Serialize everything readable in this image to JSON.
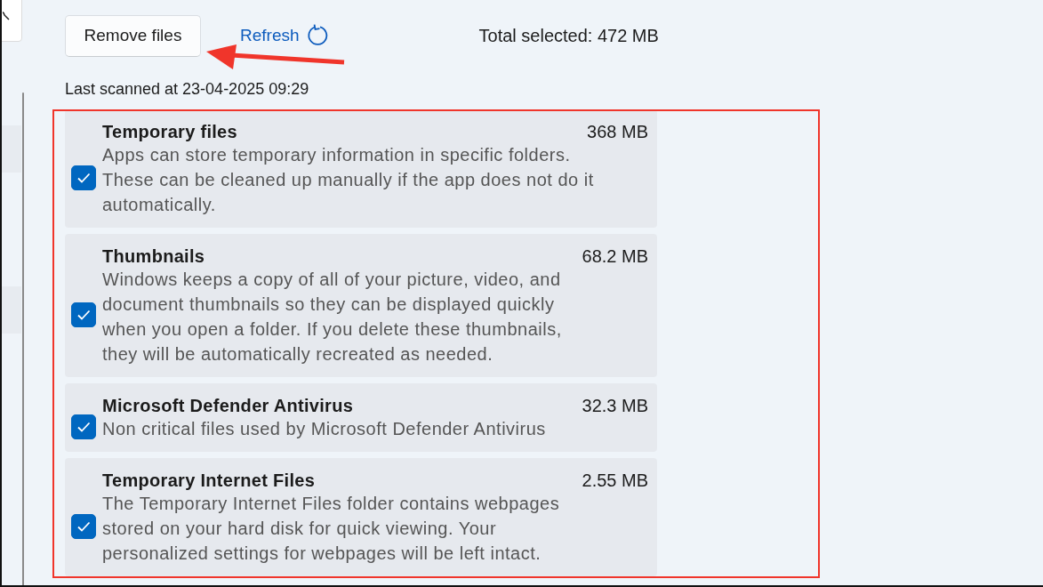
{
  "toolbar": {
    "remove_button": "Remove files",
    "refresh_link": "Refresh",
    "total_selected": "Total selected: 472 MB"
  },
  "last_scanned": "Last scanned at 23-04-2025 09:29",
  "items": [
    {
      "title": "Temporary files",
      "size": "368 MB",
      "description": "Apps can store temporary information in specific folders. These can be cleaned up manually if the app does not do it automatically.",
      "checked": true
    },
    {
      "title": "Thumbnails",
      "size": "68.2 MB",
      "description": "Windows keeps a copy of all of your picture, video, and document thumbnails so they can be displayed quickly when you open a folder. If you delete these thumbnails, they will be automatically recreated as needed.",
      "checked": true
    },
    {
      "title": "Microsoft Defender Antivirus",
      "size": "32.3 MB",
      "description": "Non critical files used by Microsoft Defender Antivirus",
      "checked": true
    },
    {
      "title": "Temporary Internet Files",
      "size": "2.55 MB",
      "description": "The Temporary Internet Files folder contains webpages stored on your hard disk for quick viewing. Your personalized settings for webpages will be left intact.",
      "checked": true
    }
  ],
  "annotations": {
    "highlight_box": true,
    "arrow": true
  }
}
